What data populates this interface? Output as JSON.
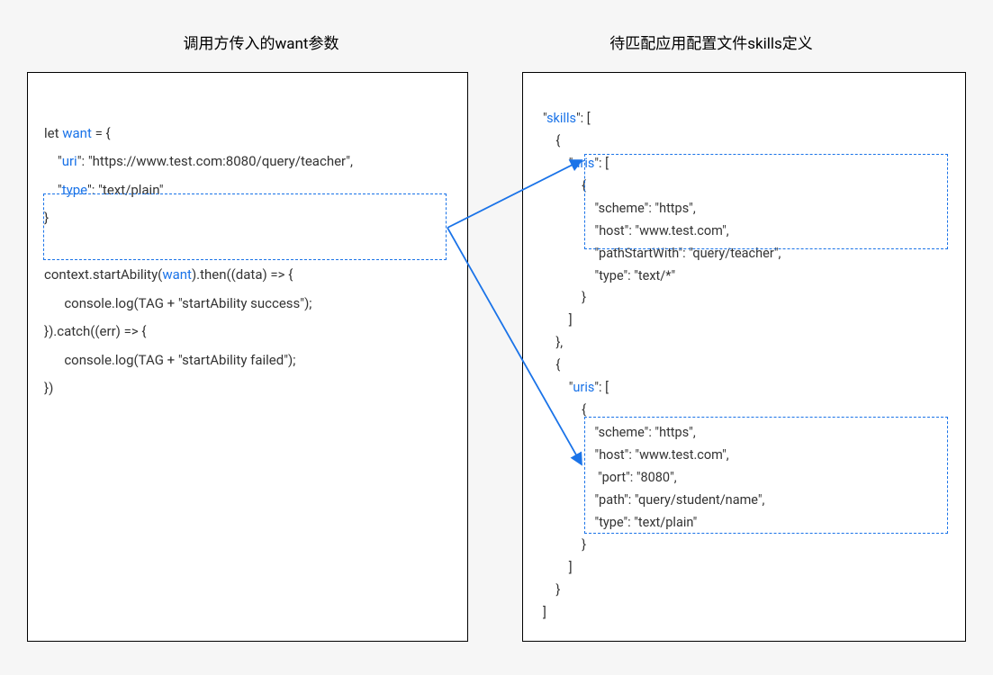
{
  "titles": {
    "left": "调用方传入的want参数",
    "right": "待匹配应用配置文件skills定义"
  },
  "leftCode": {
    "l1a": "let ",
    "l1b": "want",
    "l1c": " = {",
    "l2a": "    \"",
    "l2b": "uri",
    "l2c": "\": \"https://www.test.com:8080/query/teacher\",",
    "l3a": "    \"",
    "l3b": "type",
    "l3c": "\": \"text/plain\"",
    "l4": "}",
    "l5": "",
    "l6a": "context.startAbility(",
    "l6b": "want",
    "l6c": ").then((data) => {",
    "l7": "      console.log(TAG + \"startAbility success\");",
    "l8": "}).catch((err) => {",
    "l9": "      console.log(TAG + \"startAbility failed\");",
    "l10": "})"
  },
  "rightCode": {
    "r1a": "\"",
    "r1b": "skills",
    "r1c": "\": [",
    "r2": "    {",
    "r3a": "        \"",
    "r3b": "uris",
    "r3c": "\": [",
    "r4": "            {",
    "r5": "                \"scheme\": \"https\",",
    "r6": "                \"host\": \"www.test.com\",",
    "r7": "                \"pathStartWith\": \"query/teacher\",",
    "r8": "                \"type\": \"text/*\"",
    "r9": "            }",
    "r10": "        ]",
    "r11": "    },",
    "r12": "    {",
    "r13a": "        \"",
    "r13b": "uris",
    "r13c": "\": [",
    "r14": "            {",
    "r15": "                \"scheme\": \"https\",",
    "r16": "                \"host\": \"www.test.com\",",
    "r17": "                 \"port\": \"8080\",",
    "r18": "                \"path\": \"query/student/name\",",
    "r19": "                \"type\": \"text/plain\"",
    "r20": "            }",
    "r21": "        ]",
    "r22": "    }",
    "r23": "]"
  }
}
